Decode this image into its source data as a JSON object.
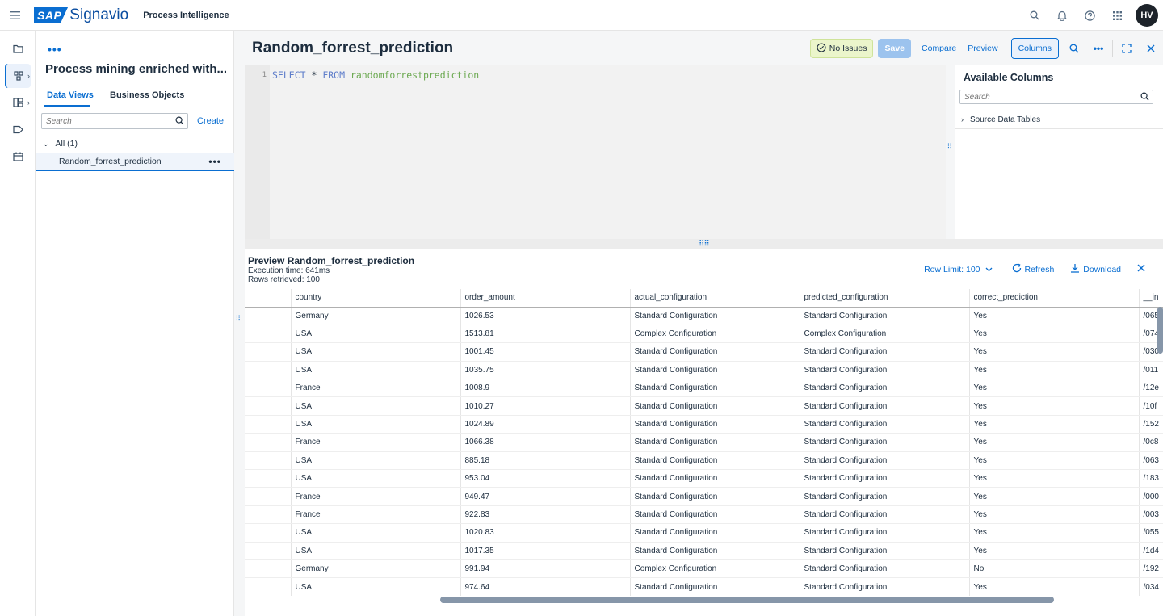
{
  "shell": {
    "logo_sap": "SAP",
    "logo_brand": "Signavio",
    "product": "Process Intelligence",
    "avatar_initials": "HV"
  },
  "panel": {
    "title": "Process mining enriched with...",
    "tabs": [
      "Data Views",
      "Business Objects"
    ],
    "search_placeholder": "Search",
    "create_label": "Create",
    "tree_all_label": "All (1)",
    "tree_item_label": "Random_forrest_prediction"
  },
  "editor": {
    "title": "Random_forrest_prediction",
    "status_label": "No Issues",
    "save_label": "Save",
    "compare_label": "Compare",
    "preview_label": "Preview",
    "columns_label": "Columns",
    "line_number": "1",
    "code": {
      "kw_select": "SELECT",
      "star": " * ",
      "kw_from": "FROM",
      "table": " randomforrestprediction"
    }
  },
  "available_columns": {
    "title": "Available Columns",
    "search_placeholder": "Search",
    "source_label": "Source Data Tables"
  },
  "preview": {
    "title": "Preview Random_forrest_prediction",
    "execution_time": "Execution time: 641ms",
    "rows_retrieved": "Rows retrieved: 100",
    "row_limit_label": "Row Limit: 100",
    "refresh_label": "Refresh",
    "download_label": "Download",
    "columns": [
      "",
      "country",
      "order_amount",
      "actual_configuration",
      "predicted_configuration",
      "correct_prediction",
      "__in"
    ],
    "rows": [
      [
        "",
        "Germany",
        "1026.53",
        "Standard Configuration",
        "Standard Configuration",
        "Yes",
        "/065"
      ],
      [
        "",
        "USA",
        "1513.81",
        "Complex Configuration",
        "Complex Configuration",
        "Yes",
        "/074"
      ],
      [
        "",
        "USA",
        "1001.45",
        "Standard Configuration",
        "Standard Configuration",
        "Yes",
        "/030"
      ],
      [
        "",
        "USA",
        "1035.75",
        "Standard Configuration",
        "Standard Configuration",
        "Yes",
        "/011"
      ],
      [
        "",
        "France",
        "1008.9",
        "Standard Configuration",
        "Standard Configuration",
        "Yes",
        "/12e"
      ],
      [
        "",
        "USA",
        "1010.27",
        "Standard Configuration",
        "Standard Configuration",
        "Yes",
        "/10f"
      ],
      [
        "",
        "USA",
        "1024.89",
        "Standard Configuration",
        "Standard Configuration",
        "Yes",
        "/152"
      ],
      [
        "",
        "France",
        "1066.38",
        "Standard Configuration",
        "Standard Configuration",
        "Yes",
        "/0c8"
      ],
      [
        "",
        "USA",
        "885.18",
        "Standard Configuration",
        "Standard Configuration",
        "Yes",
        "/063"
      ],
      [
        "",
        "USA",
        "953.04",
        "Standard Configuration",
        "Standard Configuration",
        "Yes",
        "/183"
      ],
      [
        "",
        "France",
        "949.47",
        "Standard Configuration",
        "Standard Configuration",
        "Yes",
        "/000"
      ],
      [
        "",
        "France",
        "922.83",
        "Standard Configuration",
        "Standard Configuration",
        "Yes",
        "/003"
      ],
      [
        "",
        "USA",
        "1020.83",
        "Standard Configuration",
        "Standard Configuration",
        "Yes",
        "/055"
      ],
      [
        "",
        "USA",
        "1017.35",
        "Standard Configuration",
        "Standard Configuration",
        "Yes",
        "/1d4"
      ],
      [
        "",
        "Germany",
        "991.94",
        "Complex Configuration",
        "Standard Configuration",
        "No",
        "/192"
      ],
      [
        "",
        "USA",
        "974.64",
        "Standard Configuration",
        "Standard Configuration",
        "Yes",
        "/034"
      ]
    ]
  },
  "colors": {
    "accent": "#0a6ed1",
    "status_bg": "#ebf5cb"
  }
}
